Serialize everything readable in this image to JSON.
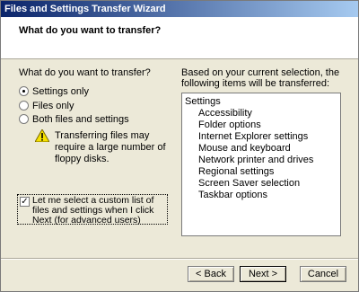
{
  "window": {
    "title": "Files and Settings Transfer Wizard"
  },
  "header": {
    "title": "What do you want to transfer?"
  },
  "left": {
    "prompt": "What do you want to transfer?",
    "options": [
      {
        "label": "Settings only",
        "checked": true
      },
      {
        "label": "Files only",
        "checked": false
      },
      {
        "label": "Both files and settings",
        "checked": false
      }
    ],
    "warning": "Transferring files may require a large number of floppy disks.",
    "custom_checkbox": {
      "label": "Let me select a custom list of files and settings when I click Next (for advanced users)",
      "checked": true
    }
  },
  "right": {
    "prompt": "Based on your current selection, the following items will be transferred:",
    "root": "Settings",
    "items": [
      "Accessibility",
      "Folder options",
      "Internet Explorer settings",
      "Mouse and keyboard",
      "Network printer and drives",
      "Regional settings",
      "Screen Saver selection",
      "Taskbar options"
    ]
  },
  "buttons": {
    "back": "< Back",
    "next": "Next >",
    "cancel": "Cancel"
  },
  "icons": {
    "warning": "warning-icon",
    "check": "checkmark-icon"
  },
  "colors": {
    "title_start": "#0a246a",
    "title_end": "#a6caf0",
    "face": "#ece9d8"
  }
}
